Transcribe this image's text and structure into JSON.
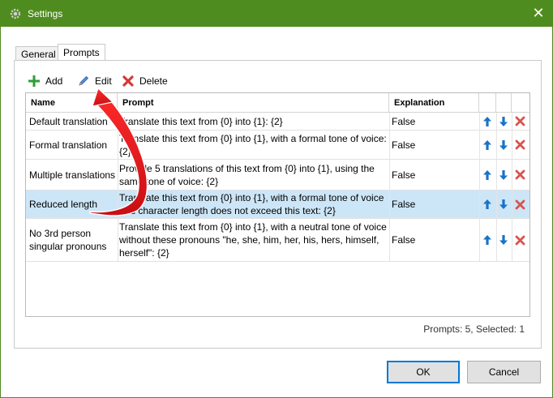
{
  "window": {
    "title": "Settings",
    "close_glyph": "✕"
  },
  "tabs": [
    {
      "label": "General",
      "active": false
    },
    {
      "label": "Prompts",
      "active": true
    }
  ],
  "toolbar": {
    "add_label": "Add",
    "edit_label": "Edit",
    "delete_label": "Delete"
  },
  "grid": {
    "columns": [
      "Name",
      "Prompt",
      "Explanation"
    ],
    "rows": [
      {
        "name": "Default translation",
        "prompt": "Translate this text from {0} into {1}: {2}",
        "explanation": "False",
        "selected": false
      },
      {
        "name": "Formal translation",
        "prompt": "Translate this text from {0} into {1}, with a formal tone of voice: {2}",
        "explanation": "False",
        "selected": false
      },
      {
        "name": "Multiple translations",
        "prompt": "Provide 5 translations of this text from {0} into {1}, using the same tone of voice: {2}",
        "explanation": "False",
        "selected": false
      },
      {
        "name": "Reduced length",
        "prompt": "Translate this text from {0} into {1}, with a formal tone of voice and character length does not exceed this text: {2}",
        "explanation": "False",
        "selected": true
      },
      {
        "name": "No 3rd person singular pronouns",
        "prompt": "Translate this text from {0} into {1}, with a neutral tone of voice without these pronouns \"he, she, him, her, his, hers, himself, herself\": {2}",
        "explanation": "False",
        "selected": false
      }
    ]
  },
  "status": "Prompts: 5, Selected: 1",
  "buttons": {
    "ok": "OK",
    "cancel": "Cancel"
  },
  "colors": {
    "titlebar": "#4f8c1f",
    "selection": "#cde6f7",
    "arrow_up_down": "#1a73c7",
    "delete_red": "#d9534f",
    "annotation_arrow": "#e8171e"
  }
}
